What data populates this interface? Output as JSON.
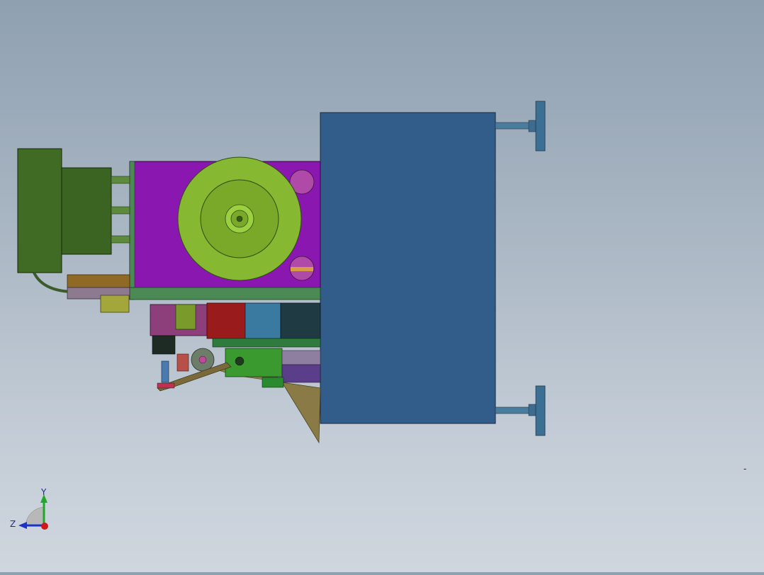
{
  "viewport": {
    "background_top": "#8fa0b1",
    "background_bottom": "#cfd6de"
  },
  "triad": {
    "y_label": "Y",
    "z_label": "Z",
    "colors": {
      "y": "#1fa82a",
      "z": "#1a32c8",
      "x": "#d01818"
    }
  },
  "marker_text": "-",
  "model": {
    "main_box_color": "#325d8a",
    "housing_color": "#8a17b0",
    "motor_color": "#3f6b25",
    "disc_color": "#86b832"
  }
}
